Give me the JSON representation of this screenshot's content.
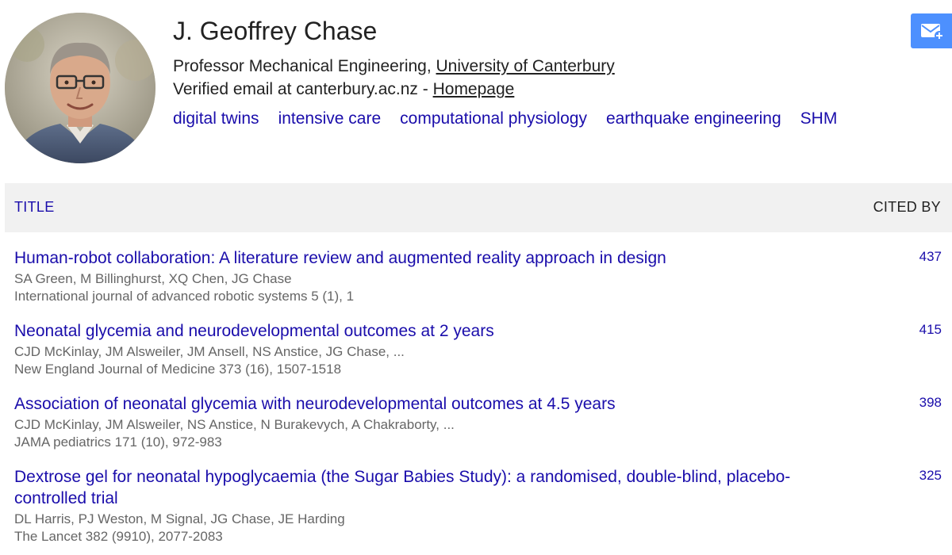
{
  "profile": {
    "name": "J. Geoffrey Chase",
    "affiliation_prefix": "Professor Mechanical Engineering, ",
    "affiliation_link": "University of Canterbury",
    "email_text": "Verified email at canterbury.ac.nz - ",
    "homepage_link": "Homepage",
    "interests": [
      "digital twins",
      "intensive care",
      "computational physiology",
      "earthquake engineering",
      "SHM"
    ]
  },
  "icons": {
    "avatar": "profile-photo",
    "follow": "mail-plus-icon"
  },
  "colors": {
    "link": "#1a0dab",
    "follow_button": "#4d90fe",
    "header_bg": "#f1f1f1",
    "meta_text": "#666666"
  },
  "table": {
    "title_header": "TITLE",
    "cited_header": "CITED BY",
    "rows": [
      {
        "title": "Human-robot collaboration: A literature review and augmented reality approach in design",
        "authors": "SA Green, M Billinghurst, XQ Chen, JG Chase",
        "venue": "International journal of advanced robotic systems 5 (1), 1",
        "cited": "437"
      },
      {
        "title": "Neonatal glycemia and neurodevelopmental outcomes at 2 years",
        "authors": "CJD McKinlay, JM Alsweiler, JM Ansell, NS Anstice, JG Chase, ...",
        "venue": "New England Journal of Medicine 373 (16), 1507-1518",
        "cited": "415"
      },
      {
        "title": "Association of neonatal glycemia with neurodevelopmental outcomes at 4.5 years",
        "authors": "CJD McKinlay, JM Alsweiler, NS Anstice, N Burakevych, A Chakraborty, ...",
        "venue": "JAMA pediatrics 171 (10), 972-983",
        "cited": "398"
      },
      {
        "title": "Dextrose gel for neonatal hypoglycaemia (the Sugar Babies Study): a randomised, double-blind, placebo-controlled trial",
        "authors": "DL Harris, PJ Weston, M Signal, JG Chase, JE Harding",
        "venue": "The Lancet 382 (9910), 2077-2083",
        "cited": "325"
      }
    ]
  }
}
